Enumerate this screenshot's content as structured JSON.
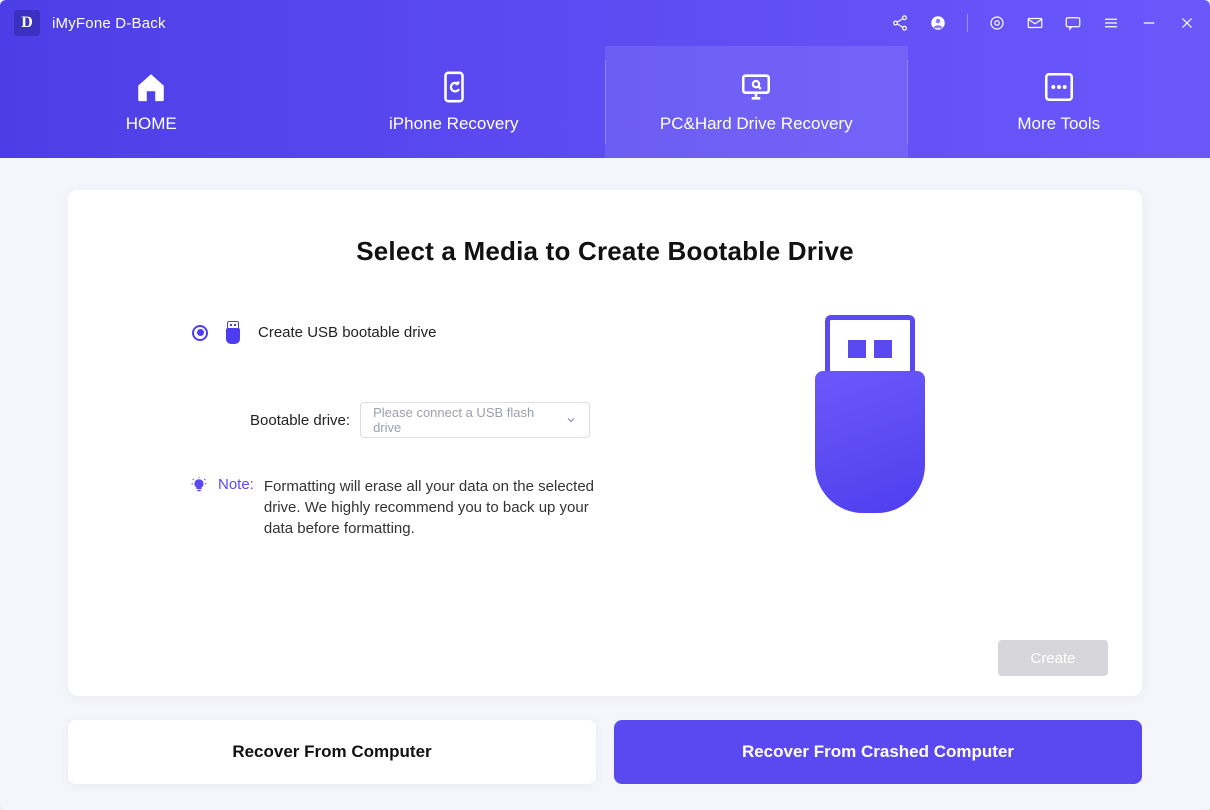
{
  "app": {
    "logo_letter": "D",
    "title": "iMyFone D-Back"
  },
  "nav": {
    "items": [
      {
        "label": "HOME"
      },
      {
        "label": "iPhone Recovery"
      },
      {
        "label": "PC&Hard Drive Recovery"
      },
      {
        "label": "More Tools"
      }
    ]
  },
  "main": {
    "heading": "Select a Media to Create Bootable Drive",
    "option_usb": "Create USB bootable drive",
    "drive_field_label": "Bootable drive:",
    "drive_placeholder": "Please connect a USB flash drive",
    "note_label": "Note:",
    "note_text": "Formatting will erase all your data on the selected drive. We highly recommend you to back up your data before formatting.",
    "create_button": "Create"
  },
  "bottom": {
    "left": "Recover From Computer",
    "right": "Recover From Crashed Computer"
  }
}
